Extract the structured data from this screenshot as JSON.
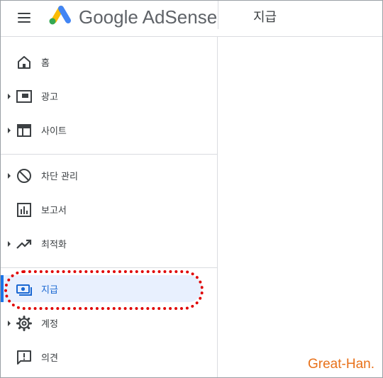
{
  "header": {
    "menu_icon": "hamburger-menu-icon",
    "logo_icon": "google-adsense-logo-icon",
    "brand": "Google AdSense",
    "page_title": "지급"
  },
  "sidebar": {
    "items": [
      {
        "label": "홈",
        "icon": "home-icon",
        "expandable": false,
        "active": false
      },
      {
        "label": "광고",
        "icon": "ads-icon",
        "expandable": true,
        "active": false
      },
      {
        "label": "사이트",
        "icon": "sites-icon",
        "expandable": true,
        "active": false
      },
      {
        "label": "차단 관리",
        "icon": "block-icon",
        "expandable": true,
        "active": false
      },
      {
        "label": "보고서",
        "icon": "reports-icon",
        "expandable": false,
        "active": false
      },
      {
        "label": "최적화",
        "icon": "trending-up-icon",
        "expandable": true,
        "active": false
      },
      {
        "label": "지급",
        "icon": "payments-icon",
        "expandable": false,
        "active": true
      },
      {
        "label": "계정",
        "icon": "settings-gear-icon",
        "expandable": true,
        "active": false
      },
      {
        "label": "의견",
        "icon": "feedback-icon",
        "expandable": false,
        "active": false
      }
    ]
  },
  "watermark": "Great-Han.",
  "colors": {
    "active_bg": "#e8f0fe",
    "active_bar": "#1a73e8",
    "active_text": "#1967d2",
    "highlight_ring": "#e00000",
    "watermark": "#e8711a"
  }
}
